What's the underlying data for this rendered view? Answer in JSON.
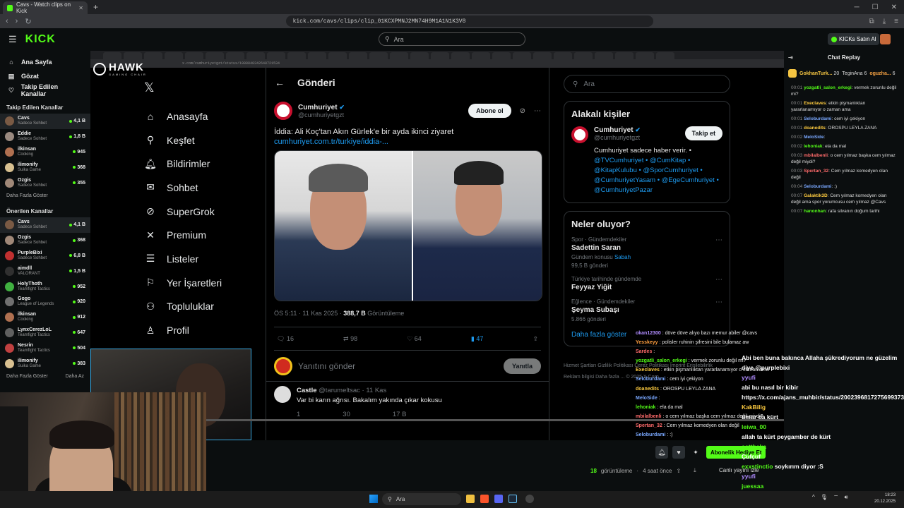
{
  "browser": {
    "tab_title": "Cavs - Watch clips on Kick",
    "url": "kick.com/cavs/clips/clip_01KCXPMNJ2MN74H9M1A1N1K3V8"
  },
  "kick": {
    "logo": "KICK",
    "search_placeholder": "Ara",
    "buy_kicks": "KICKs Satın Al",
    "nav": [
      {
        "label": "Ana Sayfa"
      },
      {
        "label": "Gözat"
      },
      {
        "label": "Takip Edilen Kanallar"
      }
    ],
    "followed_title": "Takip Edilen Kanallar",
    "followed": [
      {
        "name": "Cavs",
        "game": "Sadece Sohbet",
        "viewers": "4,1 B",
        "color": "#7a5a44"
      },
      {
        "name": "Eddie",
        "game": "Sadece Sohbet",
        "viewers": "1,8 B",
        "color": "#9a8a80"
      },
      {
        "name": "ilkinsan",
        "game": "Cooking",
        "viewers": "945",
        "color": "#b07050"
      },
      {
        "name": "ilimonify",
        "game": "Suika Game",
        "viewers": "368",
        "color": "#d8c090"
      },
      {
        "name": "Ozgis",
        "game": "Sadece Sohbet",
        "viewers": "355",
        "color": "#a08878"
      }
    ],
    "show_more": "Daha Fazla Göster",
    "show_less": "Daha Az",
    "recommended_title": "Önerilen Kanallar",
    "recommended": [
      {
        "name": "Cavs",
        "game": "Sadece Sohbet",
        "viewers": "4,1 B",
        "color": "#7a5a44"
      },
      {
        "name": "Ozgis",
        "game": "Sadece Sohbet",
        "viewers": "368",
        "color": "#a08878"
      },
      {
        "name": "PurpleBixi",
        "game": "Sadece Sohbet",
        "viewers": "6,8 B",
        "color": "#c03030"
      },
      {
        "name": "aimdll",
        "game": "VALORANT",
        "viewers": "1,5 B",
        "color": "#303030"
      },
      {
        "name": "HolyThoth",
        "game": "Teamfight Tactics",
        "viewers": "952",
        "color": "#40b040"
      },
      {
        "name": "Gogo",
        "game": "League of Legends",
        "viewers": "920",
        "color": "#707070"
      },
      {
        "name": "ilkinsan",
        "game": "Cooking",
        "viewers": "912",
        "color": "#b07050"
      },
      {
        "name": "LynxCerezLoL",
        "game": "Teamfight Tactics",
        "viewers": "647",
        "color": "#606060"
      },
      {
        "name": "Nesrin",
        "game": "Teamfight Tactics",
        "viewers": "504",
        "color": "#c04040"
      },
      {
        "name": "ilimonify",
        "game": "Suika Game",
        "viewers": "383",
        "color": "#d8c090"
      }
    ]
  },
  "stream": {
    "inner_url": "x.com/cumhuriyetgzt/status/1988848342648721534",
    "hawk_name": "HAWK",
    "hawk_sub": "GAMING CHAIR",
    "x_nav": [
      {
        "label": "Anasayfa",
        "icon": "home-icon",
        "glyph": "⌂"
      },
      {
        "label": "Keşfet",
        "icon": "search-icon",
        "glyph": "⚲"
      },
      {
        "label": "Bildirimler",
        "icon": "bell-icon",
        "glyph": "🔔︎"
      },
      {
        "label": "Sohbet",
        "icon": "mail-icon",
        "glyph": "✉"
      },
      {
        "label": "SuperGrok",
        "icon": "grok-icon",
        "glyph": "⊘"
      },
      {
        "label": "Premium",
        "icon": "x-premium-icon",
        "glyph": "✕"
      },
      {
        "label": "Listeler",
        "icon": "list-icon",
        "glyph": "☰"
      },
      {
        "label": "Yer İşaretleri",
        "icon": "bookmark-icon",
        "glyph": "⚐"
      },
      {
        "label": "Topluluklar",
        "icon": "communities-icon",
        "glyph": "⚇"
      },
      {
        "label": "Profil",
        "icon": "profile-icon",
        "glyph": "♙"
      }
    ],
    "post_header": "Gönderi",
    "author_name": "Cumhuriyet",
    "author_handle": "@cumhuriyetgzt",
    "subscribe": "Abone ol",
    "post_text": "İddia: Ali Koç'tan Akın Gürlek'e bir ayda ikinci ziyaret",
    "post_link": "cumhuriyet.com.tr/turkiye/iddia-...",
    "time": "ÖS 5:11 · 11 Kas 2025 · ",
    "views": "388,7 B",
    "views_label": " Görüntüleme",
    "replies": "16",
    "reposts": "98",
    "likes": "64",
    "bookmarks": "47",
    "reply_placeholder": "Yanıtını gönder",
    "reply_button": "Yanıtla",
    "comment_name": "Castle",
    "comment_handle": "@tarumeltsac · 11 Kas",
    "comment_text": "Var bi karın ağrısı. Bakalım yakında çıkar kokusu",
    "comment_replies": "1",
    "comment_likes": "30",
    "comment_views": "17 B",
    "search_placeholder": "Ara",
    "related_title": "Alakalı kişiler",
    "related_name": "Cumhuriyet",
    "related_handle": "@cumhuriyetgzt",
    "follow": "Takip et",
    "related_bio": "Cumhuriyet sadece haber verir. •",
    "related_links": "@TVCumhuriyet • @CumKitap • @KitapKulubu • @SporCumhuriyet • @CumhuriyetYasam • @EgeCumhuriyet • @CumhuriyetPazar",
    "trends_title": "Neler oluyor?",
    "trends": [
      {
        "cat": "Spor · Gündemdekiler",
        "title": "Sadettin Saran",
        "extra": "Gündem konusu",
        "link": "Sabah",
        "count": "99,5 B gönderi"
      },
      {
        "cat": "Türkiye tarihinde gündemde",
        "title": "Feyyaz Yiğit",
        "extra": "",
        "link": "",
        "count": ""
      },
      {
        "cat": "Eğlence · Gündemdekiler",
        "title": "Şeyma Subaşı",
        "extra": "",
        "link": "",
        "count": "5.866 gönderi"
      }
    ],
    "trends_more": "Daha fazla göster",
    "footer": "Hizmet Şartları   Gizlilik Politikası   Çerez Politikası   Imprint   Erişilebilirlik   Reklam bilgisi   Daha fazla ...   © 2025 X Corp.",
    "overlay_chat": [
      {
        "user": "okan12300",
        "text": " döve döve alıyo bazı memur abiler @cavs",
        "color": "#b08cff"
      },
      {
        "user": "Yesskeyy",
        "text": " polisler ruhinin şifresini bile bulamaz aw",
        "color": "#ff9f40"
      },
      {
        "user": "Sardes",
        "text": " ",
        "color": "#ff6b6b"
      },
      {
        "user": "yozgatli_salon_erkegi",
        "text": " vermek zorunlu değil mi?",
        "color": "#53fc18"
      },
      {
        "user": "Execlaves",
        "text": " etkin pişmanlıktan yararlanamıyor o zaman ama",
        "color": "#ffcc40"
      },
      {
        "user": "Seloburdami",
        "text": " cem iyi çekiyon",
        "color": "#7aa8ff"
      },
      {
        "user": "doanedits",
        "text": " OROSPU LEYLA ZANA",
        "color": "#ffcc40"
      },
      {
        "user": "MeloSide",
        "text": " ",
        "color": "#7aa8ff"
      },
      {
        "user": "lehoniak",
        "text": " ela da mal",
        "color": "#53fc18"
      },
      {
        "user": "mbilalbenli",
        "text": " o cem yılmaz başka cem yılmaz değil miydi?",
        "color": "#ff6b6b"
      },
      {
        "user": "Spertan_32",
        "text": " Cem yılmaz komedyen olan değil",
        "color": "#ff6b6b"
      },
      {
        "user": "Seloburdami",
        "text": " :)",
        "color": "#7aa8ff"
      }
    ]
  },
  "video": {
    "views": "18",
    "views_label": "görüntüleme",
    "ago": "4 saat önce",
    "subscribe": "Abonelik Hediye Et",
    "live": "Canlı yayını izle"
  },
  "chat": {
    "title": "Chat Replay",
    "gift1_user": "GokhanTurk...",
    "gift1_count": "20",
    "gift2_user": "TeginAna",
    "gift2_count": "6",
    "gift3_user": "oguzha...",
    "gift3_count": "6",
    "messages": [
      {
        "time": "00:01",
        "user": "yozgatli_salon_erkegi",
        "text": ": vermek zorunlu değil mi?",
        "color": "#53fc18"
      },
      {
        "time": "00:01",
        "user": "Execlaves",
        "text": ": etkin pişmanlıktan yararlanamıyor o zaman ama",
        "color": "#ffcc40"
      },
      {
        "time": "00:01",
        "user": "Seloburdami",
        "text": ": cem iyi çekiyon",
        "color": "#7aa8ff"
      },
      {
        "time": "00:01",
        "user": "doanedits",
        "text": ": OROSPU LEYLA ZANA",
        "color": "#ffcc40"
      },
      {
        "time": "00:02",
        "user": "MeloSide",
        "text": ":",
        "color": "#7aa8ff"
      },
      {
        "time": "00:02",
        "user": "lehoniak",
        "text": ": ela da mal",
        "color": "#53fc18"
      },
      {
        "time": "00:03",
        "user": "mbilalbenli",
        "text": ": o cem yılmaz başka cem yılmaz değil miydi?",
        "color": "#ff6b6b"
      },
      {
        "time": "00:03",
        "user": "Spertan_32",
        "text": ": Cem yılmaz komedyen olan değil",
        "color": "#ff6b6b"
      },
      {
        "time": "00:04",
        "user": "Seloburdami",
        "text": ": :)",
        "color": "#7aa8ff"
      },
      {
        "time": "00:07",
        "user": "Galaktik3D",
        "text": ": Cem yılmaz komedyen olan değil ama spor yorumcusu cem yılmaz @Cavs",
        "color": "#ffcc40"
      },
      {
        "time": "00:07",
        "user": "hanonhan",
        "text": ": rafa silvanın doğum tarihi",
        "color": "#53fc18"
      }
    ],
    "overlay": [
      {
        "user": "",
        "text": "Abi ben buna bakınca Allaha şükrediyorum ne güzelim diye @purplebixi",
        "color": "#ffffff"
      },
      {
        "user": "yyufi",
        "text": "",
        "color": "#b08cff"
      },
      {
        "user": "",
        "text": "abi bu nasıl bir kibir https://x.com/ajans_muhbir/status/2002396817275699373?",
        "color": "#ffffff"
      },
      {
        "user": "KakBilig",
        "text": "",
        "color": "#ffcc40"
      },
      {
        "user": "",
        "text": "timur da kürt",
        "color": "#ffffff"
      },
      {
        "user": "leiwa_00",
        "text": "",
        "color": "#53fc18"
      },
      {
        "user": "",
        "text": "allah ta kürt peygamber de kürt",
        "color": "#ffffff"
      },
      {
        "user": "cottheka",
        "text": "",
        "color": "#53fc18"
      },
      {
        "user": "",
        "text": "Çufçuf",
        "color": "#ffffff"
      },
      {
        "user": "exxstinctio",
        "text": " soykırım diyor :S",
        "color": "#53fc18"
      },
      {
        "user": "yyufi",
        "text": "",
        "color": "#b08cff"
      },
      {
        "user": "juessaa",
        "text": "",
        "color": "#53fc18"
      }
    ]
  },
  "taskbar": {
    "search": "Ara",
    "time": "18:23",
    "date": "20.12.2025"
  }
}
